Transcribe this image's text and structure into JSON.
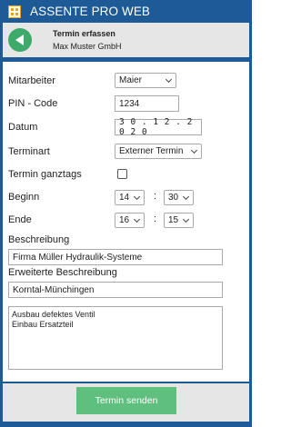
{
  "app": {
    "title": "ASSENTE PRO WEB",
    "icon": "app-grid-icon"
  },
  "header": {
    "title": "Termin erfassen",
    "company": "Max Muster GmbH",
    "back_icon": "back-arrow-icon"
  },
  "form": {
    "employee": {
      "label": "Mitarbeiter",
      "value": "Maier"
    },
    "pin": {
      "label": "PIN - Code",
      "value": "1234"
    },
    "date": {
      "label": "Datum",
      "value": "30.12.2020"
    },
    "type": {
      "label": "Terminart",
      "value": "Externer Termin"
    },
    "all_day": {
      "label": "Termin ganztags",
      "checked": false
    },
    "begin": {
      "label": "Beginn",
      "hour": "14",
      "minute": "30",
      "separator": ":"
    },
    "end": {
      "label": "Ende",
      "hour": "16",
      "minute": "15",
      "separator": ":"
    },
    "description": {
      "label": "Beschreibung",
      "value": "Firma Müller Hydraulik-Systeme"
    },
    "extended": {
      "label": "Erweiterte Beschreibung",
      "value": "Korntal-Münchingen",
      "notes": "Ausbau defektes Ventil\nEinbau Ersatzteil"
    }
  },
  "submit": {
    "label": "Termin senden"
  },
  "colors": {
    "brand_blue": "#1d5a96",
    "accent_green": "#3caa68",
    "button_green": "#5fbf7e",
    "panel_gray": "#e6e6e6"
  }
}
